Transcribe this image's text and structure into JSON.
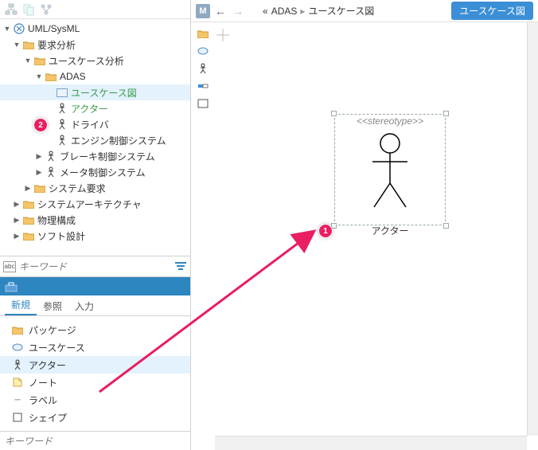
{
  "tree": {
    "root": "UML/SysML",
    "nodes": {
      "req_analysis": "要求分析",
      "usecase_analysis": "ユースケース分析",
      "adas": "ADAS",
      "usecase_diagram": "ユースケース図",
      "actor": "アクター",
      "driver": "ドライバ",
      "engine": "エンジン制御システム",
      "brake": "ブレーキ制御システム",
      "meter": "メータ制御システム",
      "system_req": "システム要求",
      "system_arch": "システムアーキテクチャ",
      "phys_struct": "物理構成",
      "soft_design": "ソフト設計"
    }
  },
  "badge2": "2",
  "search": {
    "placeholder": "キーワード"
  },
  "tabs": {
    "new": "新規",
    "ref": "参照",
    "input": "入力"
  },
  "create_items": {
    "package": "パッケージ",
    "usecase": "ユースケース",
    "actor": "アクター",
    "note": "ノート",
    "label": "ラベル",
    "shape": "シェイプ"
  },
  "bottom_kw": {
    "placeholder": "キーワード"
  },
  "right": {
    "m": "M",
    "crumb_prefix": "«",
    "crumb1": "ADAS",
    "crumb_sep": "▸",
    "crumb2": "ユースケース図",
    "tag": "ユースケース図"
  },
  "canvas": {
    "stereotype": "<<stereotype>>",
    "actor_label": "アクター"
  },
  "badge1": "1"
}
